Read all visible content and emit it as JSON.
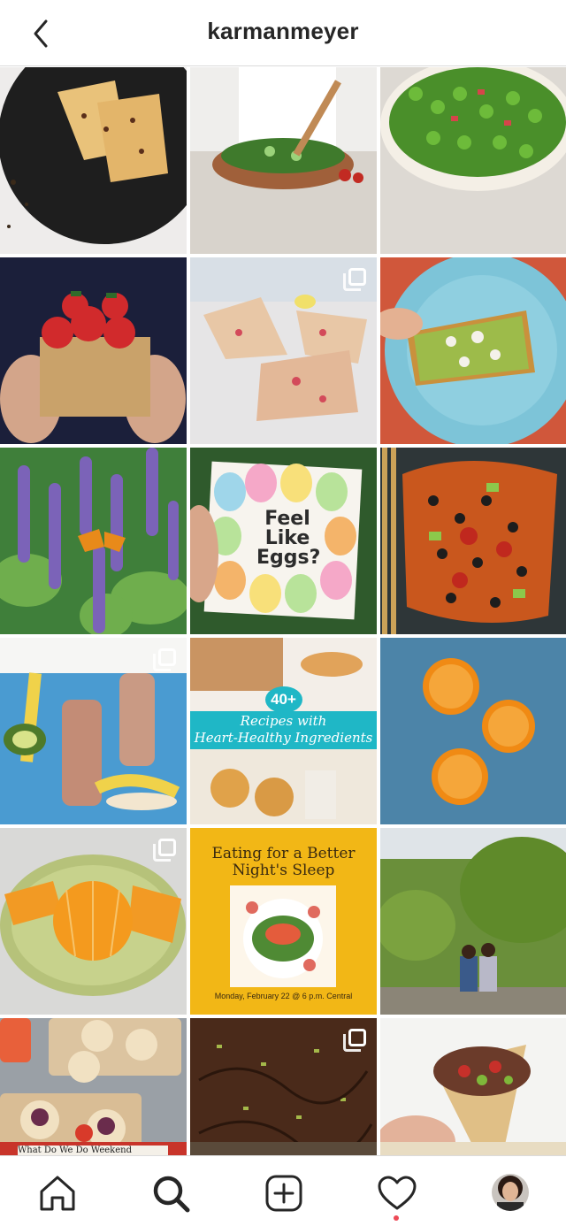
{
  "header": {
    "username": "karmanmeyer"
  },
  "posts": [
    {
      "alt": "scones on plate",
      "multi": false
    },
    {
      "alt": "tossing salad",
      "multi": false
    },
    {
      "alt": "pea salad",
      "multi": false
    },
    {
      "alt": "strawberry basket",
      "multi": false
    },
    {
      "alt": "strawberry scones",
      "multi": true
    },
    {
      "alt": "avocado toast",
      "multi": false
    },
    {
      "alt": "butterfly on lavender",
      "multi": false
    },
    {
      "alt": "book cover",
      "multi": false
    },
    {
      "alt": "loaded sweet potato",
      "multi": false
    },
    {
      "alt": "smoothie bottles",
      "multi": true
    },
    {
      "alt": "heart healthy recipes",
      "multi": false
    },
    {
      "alt": "orange slices",
      "multi": false
    },
    {
      "alt": "peeled orange",
      "multi": true
    },
    {
      "alt": "sleep webinar",
      "multi": false
    },
    {
      "alt": "couple on bench",
      "multi": false
    },
    {
      "alt": "tacos tray",
      "multi": false
    },
    {
      "alt": "chocolate bark",
      "multi": true
    },
    {
      "alt": "wrap",
      "multi": false
    }
  ],
  "book": {
    "title_line1": "Feel",
    "title_line2": "Like",
    "title_line3": "Eggs?"
  },
  "recipes_post": {
    "badge": "40+",
    "line1": "Recipes with",
    "line2": "Heart-Healthy Ingredients"
  },
  "sleep_post": {
    "line1": "Eating for a Better",
    "line2": "Night's Sleep",
    "date": "Monday, February 22 @ 6 p.m. Central"
  },
  "bottom_strip": {
    "text": "What Do We Do Weekend"
  },
  "colors": {
    "accent_red": "#ed4956",
    "divider": "#dbdbdb",
    "icon": "#262626"
  }
}
